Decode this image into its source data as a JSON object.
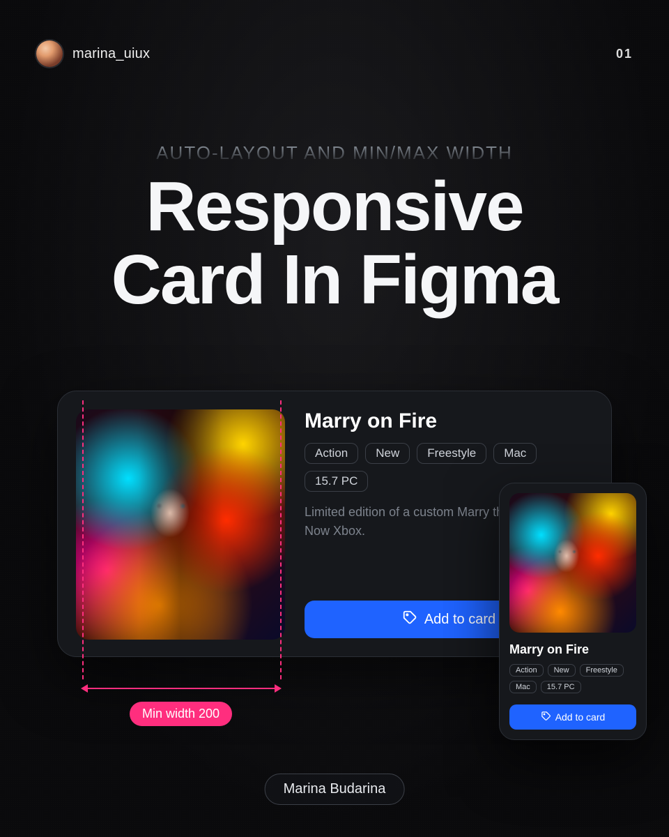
{
  "header": {
    "handle": "marina_uiux",
    "page": "01"
  },
  "kicker": "AUTO-LAYOUT AND MIN/MAX WIDTH",
  "title_line1": "Responsive",
  "title_line2": "Card In Figma",
  "card": {
    "title": "Marry on Fire",
    "tags": [
      "Action",
      "New",
      "Freestyle",
      "Mac",
      "15.7 PC"
    ],
    "description": "Limited edition of a custom Marry the Fire or die. Now Xbox.",
    "button": "Add to card"
  },
  "card_small": {
    "title": "Marry on Fire",
    "tags": [
      "Action",
      "New",
      "Freestyle",
      "Mac",
      "15.7 PC"
    ],
    "button": "Add to card"
  },
  "annotation": "Min width 200",
  "author": "Marina Budarina",
  "colors": {
    "accent": "#1f63ff",
    "annotation": "#ff2e7e",
    "surface": "#16181c",
    "border": "#2b2f36"
  }
}
